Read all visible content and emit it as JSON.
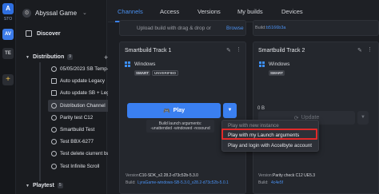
{
  "rail": {
    "logo": "A",
    "sto": "STO",
    "workspaces": [
      "AV",
      "TE"
    ],
    "add": "+"
  },
  "org": {
    "name": "Abyssal Game"
  },
  "sidebar": {
    "discover": "Discover",
    "distribution": {
      "label": "Distribution",
      "count": "9"
    },
    "items": [
      {
        "label": "05/05/2023 SB Temp-Fix"
      },
      {
        "label": "Auto update Legacy"
      },
      {
        "label": "Auto update SB + Legacy"
      },
      {
        "label": "Distribution Channel"
      },
      {
        "label": "Parity test C12"
      },
      {
        "label": "Smartbuild Test"
      },
      {
        "label": "Test BBX-6277"
      },
      {
        "label": "Test delete ciurrent build"
      },
      {
        "label": "Test Infinite Scroll"
      }
    ],
    "playtest": {
      "label": "Playtest",
      "count": "5"
    }
  },
  "tabs": [
    {
      "label": "Channels",
      "active": true
    },
    {
      "label": "Access"
    },
    {
      "label": "Versions"
    },
    {
      "label": "My builds"
    },
    {
      "label": "Devices"
    }
  ],
  "cards": {
    "top_left": {
      "upload": "Upload build with drag & drop or",
      "browse": "Browse"
    },
    "top_right": {
      "label": "Build:",
      "value": "b5166b3a"
    },
    "track1": {
      "title": "Smartbuild Track 1",
      "platform": "Windows",
      "badges": [
        "SMART",
        "UNVERIFIED"
      ],
      "play": "Play",
      "tooltip_line1": "Build launch arguments:",
      "tooltip_line2": "-unattended -windowed -nosound",
      "version_label": "Version:",
      "version_value": "C10-SDK_x2.28.2-d73c52b-5.3.0",
      "build_label": "Build:",
      "build_value": "LyraGame-windows-SB-5.3.0_x28.2-d73c52b-5.0.1"
    },
    "track2": {
      "title": "Smartbuild Track 2",
      "platform": "Windows",
      "badges": [
        "SMART"
      ],
      "update": "Update",
      "count": "0 B",
      "version_label": "Version:",
      "version_value": "Parity check C12 UE5.3",
      "build_label": "Build:",
      "build_value": "4c4e5f"
    }
  },
  "menu": {
    "items": [
      {
        "label": "Play with new instance",
        "state": "disabled"
      },
      {
        "label": "Play with my Launch arguments",
        "state": "highlighted"
      },
      {
        "label": "Play and login with Accelbyte account",
        "state": "normal"
      }
    ]
  },
  "colors": {
    "accent": "#3a7ff0",
    "highlight_border": "#e02a2a",
    "background": "#1c1e23"
  }
}
